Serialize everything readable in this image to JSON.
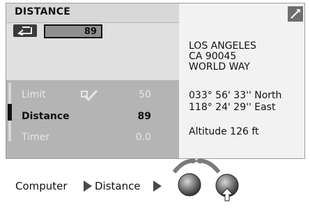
{
  "title": "DISTANCE",
  "value": {
    "display": "89",
    "back_icon": "back-arrow-icon"
  },
  "list": {
    "items": [
      {
        "label": "Limit",
        "value": "50",
        "state": "muted"
      },
      {
        "label": "Distance",
        "value": "89",
        "state": "selected"
      },
      {
        "label": "Timer",
        "value": "0.0",
        "state": "muted"
      }
    ]
  },
  "location": {
    "address_line1": "LOS ANGELES",
    "address_line2": "CA 90045",
    "address_line3": "WORLD WAY",
    "latitude": "033° 56' 33'' North",
    "longitude": "118° 24' 29'' East",
    "altitude": "Altitude 126 ft"
  },
  "breadcrumb": {
    "item1": "Computer",
    "item2": "Distance"
  },
  "colors": {
    "selected_row": "#111111",
    "muted_row": "#e6e6e6",
    "panel_gray": "#b4b4b4"
  }
}
